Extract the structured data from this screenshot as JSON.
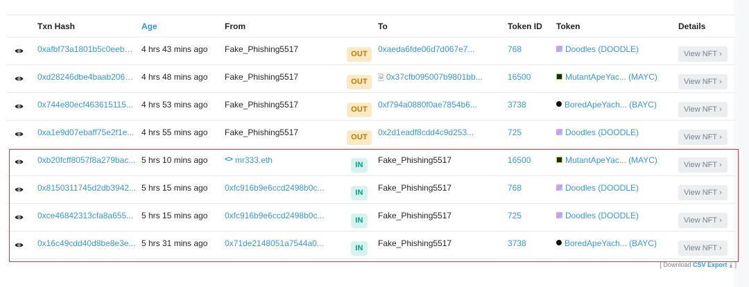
{
  "headers": {
    "txn_hash": "Txn Hash",
    "age": "Age",
    "from": "From",
    "to": "To",
    "token_id": "Token ID",
    "token": "Token",
    "details": "Details"
  },
  "rows": [
    {
      "hash": "0xafbf73a1801b5c0eeb6...",
      "age": "4 hrs 43 mins ago",
      "from": "Fake_Phishing5517",
      "from_type": "text",
      "direction": "OUT",
      "to": "0xaeda6fde06d7d067e7...",
      "to_type": "link",
      "token_id": "768",
      "token": "Doodles (DOODLE)",
      "token_icon": "doodles-icon",
      "details": "View NFT"
    },
    {
      "hash": "0xd28246dbe4baab2065...",
      "age": "4 hrs 48 mins ago",
      "from": "Fake_Phishing5517",
      "from_type": "text",
      "direction": "OUT",
      "to": "0x37cfb095007b9801bb...",
      "to_type": "contract",
      "token_id": "16500",
      "token": "MutantApeYac... (MAYC)",
      "token_icon": "mayc-icon",
      "details": "View NFT"
    },
    {
      "hash": "0x744e80ecf463615115...",
      "age": "4 hrs 53 mins ago",
      "from": "Fake_Phishing5517",
      "from_type": "text",
      "direction": "OUT",
      "to": "0xf794a0880f0ae7854b6...",
      "to_type": "link",
      "token_id": "3738",
      "token": "BoredApeYach... (BAYC)",
      "token_icon": "bayc-icon",
      "details": "View NFT"
    },
    {
      "hash": "0xa1e9d07ebaff75e2f1e...",
      "age": "4 hrs 55 mins ago",
      "from": "Fake_Phishing5517",
      "from_type": "text",
      "direction": "OUT",
      "to": "0x2d1eadf8cdd4c9d253...",
      "to_type": "link",
      "token_id": "725",
      "token": "Doodles (DOODLE)",
      "token_icon": "doodles-icon",
      "details": "View NFT"
    },
    {
      "hash": "0xb20fcff8057f8a279bac...",
      "age": "5 hrs 10 mins ago",
      "from": "mr333.eth",
      "from_type": "ens",
      "direction": "IN",
      "to": "Fake_Phishing5517",
      "to_type": "text",
      "token_id": "16500",
      "token": "MutantApeYac... (MAYC)",
      "token_icon": "mayc-icon",
      "details": "View NFT"
    },
    {
      "hash": "0x8150311745d2db3942...",
      "age": "5 hrs 15 mins ago",
      "from": "0xfc916b9e6ccd2498b0c...",
      "from_type": "link",
      "direction": "IN",
      "to": "Fake_Phishing5517",
      "to_type": "text",
      "token_id": "768",
      "token": "Doodles (DOODLE)",
      "token_icon": "doodles-icon",
      "details": "View NFT"
    },
    {
      "hash": "0xce46842313cfa8a655...",
      "age": "5 hrs 15 mins ago",
      "from": "0xfc916b9e6ccd2498b0c...",
      "from_type": "link",
      "direction": "IN",
      "to": "Fake_Phishing5517",
      "to_type": "text",
      "token_id": "725",
      "token": "Doodles (DOODLE)",
      "token_icon": "doodles-icon",
      "details": "View NFT"
    },
    {
      "hash": "0x16c49cdd40d8be8e3e...",
      "age": "5 hrs 31 mins ago",
      "from": "0x71de2148051a7544a0...",
      "from_type": "link",
      "direction": "IN",
      "to": "Fake_Phishing5517",
      "to_type": "text",
      "token_id": "3738",
      "token": "BoredApeYach... (BAYC)",
      "token_icon": "bayc-icon",
      "details": "View NFT"
    }
  ],
  "download": {
    "prefix": "[ Download",
    "link": "CSV Export",
    "suffix": "]"
  },
  "colors": {
    "link": "#3498db",
    "out_badge_bg": "#fbe8c4",
    "out_badge_text": "#b47d00",
    "in_badge_bg": "#d6f2ec",
    "in_badge_text": "#00a186",
    "highlight_border": "#e4333d"
  },
  "icons": {
    "eye": "eye-icon",
    "chevron": "chevron-right-icon",
    "contract": "contract-document-icon",
    "ens": "code-brackets-icon",
    "download": "download-icon"
  }
}
